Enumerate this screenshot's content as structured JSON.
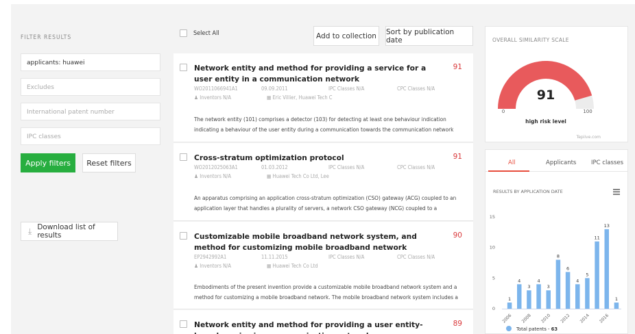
{
  "filters": {
    "title": "FILTER RESULTS",
    "applicants_value": "applicants: huawei",
    "excludes_placeholder": "Excludes",
    "patent_number_placeholder": "International patent number",
    "ipc_placeholder": "IPC classes",
    "apply_label": "Apply filters",
    "reset_label": "Reset filters",
    "download_label": "Download list of results"
  },
  "toolbar": {
    "select_all_label": "Select All",
    "add_collection_label": "Add to collection",
    "sort_label": "Sort by publication date"
  },
  "results": [
    {
      "title": "Network entity and method for providing a service for a user entity in a communication network",
      "score": "91",
      "number": "WO2011066941A1",
      "date": "09.09.2011",
      "ipc": "IPC Classes N/A",
      "cpc": "CPC Classes N/A",
      "inventors": "Inventors N/A",
      "applicant": "Eric Villier, Huawei Tech C",
      "abstract": "The network entity (101) comprises a detector (103) for detecting at least one behaviour indication indicating a behaviour of the user entity during a communication towards the communication network"
    },
    {
      "title": "Cross-stratum optimization protocol",
      "score": "91",
      "number": "WO2012025063A1",
      "date": "01.03.2012",
      "ipc": "IPC Classes N/A",
      "cpc": "CPC Classes N/A",
      "inventors": "Inventors N/A",
      "applicant": "Huawei Tech Co Ltd, Lee",
      "abstract": "An apparatus comprising an application cross-stratum optimization (CSO) gateway (ACG) coupled to an application layer that handles a plurality of servers, a network CSO gateway (NCG) coupled to a"
    },
    {
      "title": "Customizable mobile broadband network system, and method for customizing mobile broadband network",
      "score": "90",
      "number": "EP2942992A1",
      "date": "11.11.2015",
      "ipc": "IPC Classes N/A",
      "cpc": "CPC Classes N/A",
      "inventors": "Inventors N/A",
      "applicant": "Huawei Tech Co Ltd",
      "abstract": "Embodiments of the present invention provide a customizable mobile broadband network system and a method for customizing a mobile broadband network. The mobile broadband network system includes a"
    },
    {
      "title": "Network entity and method for providing a user entity-based service in a communication network",
      "score": "89"
    }
  ],
  "similarity": {
    "title": "OVERALL SIMILARITY SCALE",
    "value": "91",
    "fraction": 0.91,
    "min_label": "0",
    "max_label": "100",
    "risk_label": "high risk level",
    "credit": "Tepiive.com",
    "fill_color": "#e85a5c",
    "track_color": "#ececec"
  },
  "stats": {
    "tabs": [
      "All",
      "Applicants",
      "IPC classes"
    ],
    "chart_title": "RESULTS BY APPLICATION DATE",
    "menu_icon": "hamburger-menu-icon",
    "legend_label": "Total patents - ",
    "legend_value": "63",
    "bar_color": "#7cb5ec"
  },
  "chart_data": {
    "type": "bar",
    "title": "RESULTS BY APPLICATION DATE",
    "categories": [
      "2006",
      "2007",
      "2008",
      "2009",
      "2010",
      "2011",
      "2012",
      "2013",
      "2014",
      "2015",
      "2016",
      "2017"
    ],
    "tick_labels": [
      "2006",
      "2008",
      "2010",
      "2012",
      "2014",
      "2016"
    ],
    "values": [
      1,
      4,
      3,
      4,
      3,
      8,
      6,
      4,
      5,
      11,
      13,
      1
    ],
    "ylim": [
      0,
      15
    ],
    "yticks": [
      "0",
      "5",
      "10",
      "15"
    ],
    "series": [
      {
        "name": "Total patents",
        "values": [
          1,
          4,
          3,
          4,
          3,
          8,
          6,
          4,
          5,
          11,
          13,
          1
        ]
      }
    ],
    "legend_placement": "bottom",
    "grid": false
  }
}
